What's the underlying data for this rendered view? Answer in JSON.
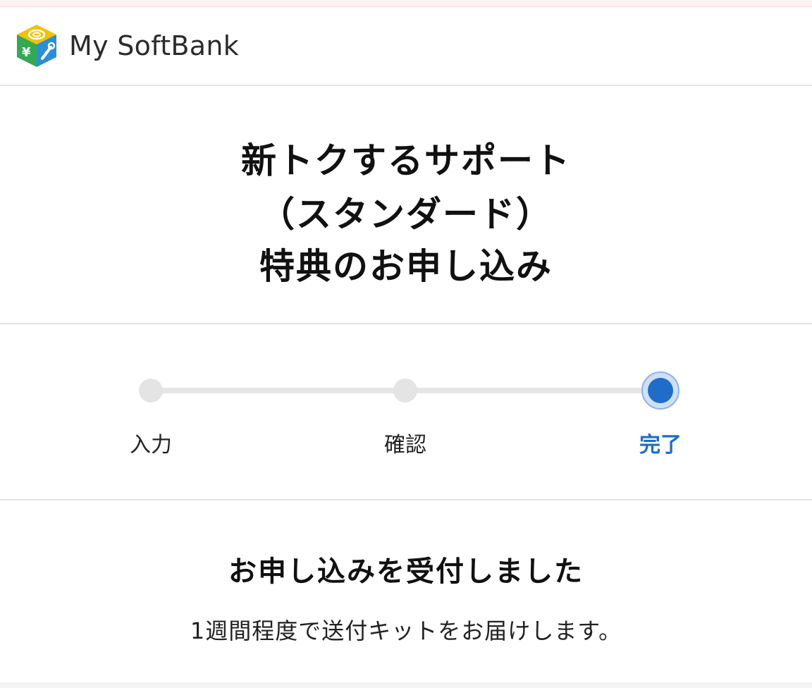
{
  "header": {
    "logo_text": "My SoftBank",
    "logo_icon": "my-softbank-cube-icon"
  },
  "title": {
    "line1": "新トクするサポート",
    "line2": "（スタンダード）",
    "line3": "特典のお申し込み"
  },
  "stepper": {
    "steps": [
      {
        "label": "入力"
      },
      {
        "label": "確認"
      },
      {
        "label": "完了"
      }
    ],
    "current_step": 3,
    "active_color": "#1f6dc9",
    "inactive_color": "#e4e4e4"
  },
  "result": {
    "heading": "お申し込みを受付しました",
    "message": "1週間程度で送付キットをお届けします。"
  }
}
